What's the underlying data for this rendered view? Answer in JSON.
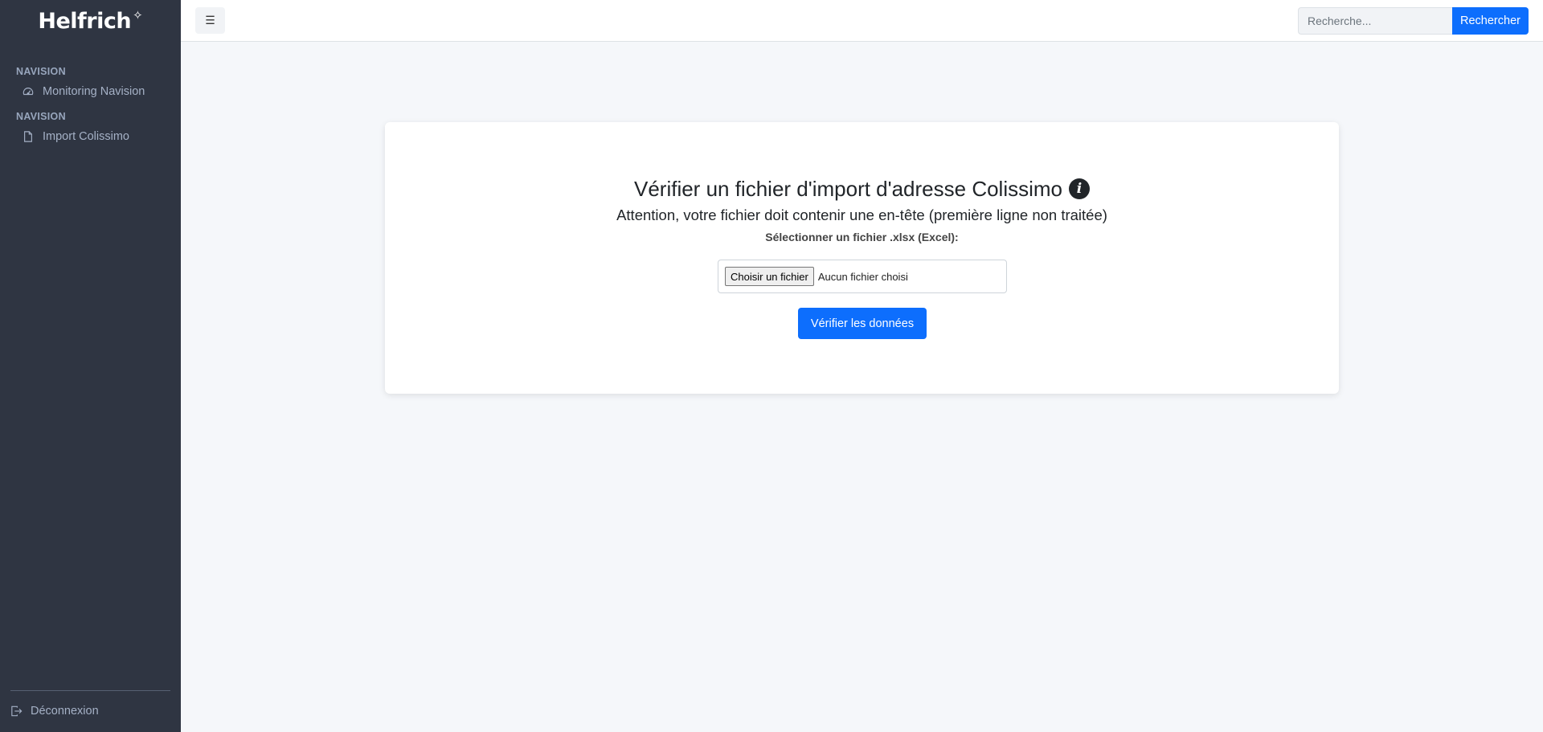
{
  "brand": {
    "name": "Helfrich",
    "mark": "✧"
  },
  "sidebar": {
    "sections": [
      {
        "heading": "NAVISION",
        "item": {
          "label": "Monitoring Navision",
          "icon": "speedometer-icon"
        }
      },
      {
        "heading": "NAVISION",
        "item": {
          "label": "Import Colissimo",
          "icon": "file-icon"
        }
      }
    ],
    "logout": {
      "label": "Déconnexion",
      "icon": "logout-icon"
    }
  },
  "topbar": {
    "menu_toggle": "☰",
    "search_placeholder": "Recherche...",
    "search_button": "Rechercher"
  },
  "main": {
    "title": "Vérifier un fichier d'import d'adresse Colissimo",
    "info_glyph": "i",
    "subtitle": "Attention, votre fichier doit contenir une en-tête (première ligne non traitée)",
    "file_label": "Sélectionner un fichier .xlsx (Excel):",
    "file_button": "Choisir un fichier",
    "file_status": "Aucun fichier choisi",
    "submit_button": "Vérifier les données"
  },
  "colors": {
    "sidebar_bg": "#2f3542",
    "accent": "#0d6efd",
    "page_bg": "#f5f7fa"
  }
}
